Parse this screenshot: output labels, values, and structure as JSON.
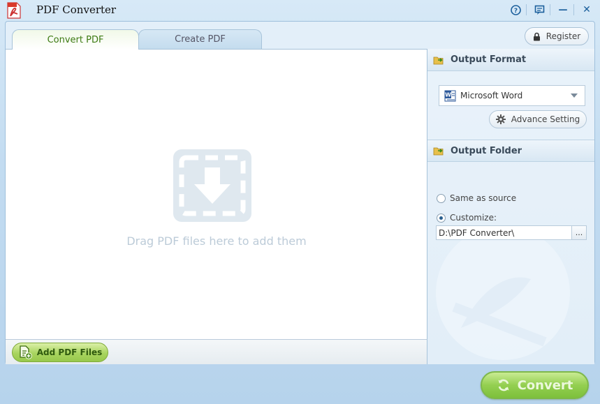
{
  "window": {
    "title": "PDF Converter",
    "controls": {
      "help": "?",
      "minimize": "—",
      "close": "✕"
    }
  },
  "tabs": [
    {
      "label": "Convert PDF",
      "active": true
    },
    {
      "label": "Create PDF",
      "active": false
    }
  ],
  "header": {
    "register_label": "Register"
  },
  "drop_area": {
    "hint": "Drag PDF files here to add them"
  },
  "bottom_bar": {
    "add_files_label": "Add PDF Files"
  },
  "output_format": {
    "title": "Output Format",
    "selected": "Microsoft Word",
    "format_badge": "W",
    "advance_label": "Advance Setting"
  },
  "output_folder": {
    "title": "Output Folder",
    "options": [
      {
        "label": "Same as source",
        "checked": false
      },
      {
        "label": "Customize:",
        "checked": true
      }
    ],
    "path": "D:\\PDF Converter\\",
    "browse_label": "..."
  },
  "convert": {
    "label": "Convert"
  },
  "colors": {
    "accent_green": "#94cf51",
    "tab_active_text": "#3c7a12",
    "frame_blue": "#c3dcf1",
    "drop_hint": "#bccbd8"
  }
}
